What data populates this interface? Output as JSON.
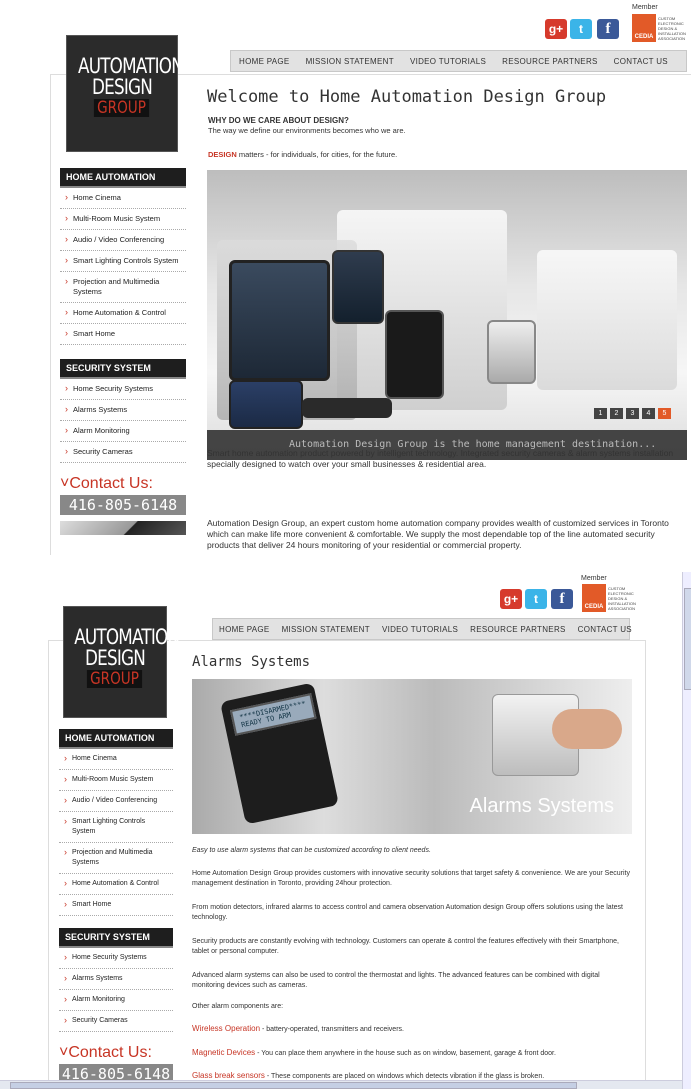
{
  "header": {
    "member_label": "Member",
    "social": {
      "gplus": "g+",
      "twitter": "t",
      "facebook": "f"
    },
    "cedia_label": "CEDIA",
    "cedia_text": "CUSTOM ELECTRONIC DESIGN & INSTALLATION ASSOCIATION",
    "nav": [
      "HOME PAGE",
      "MISSION STATEMENT",
      "VIDEO TUTORIALS",
      "RESOURCE PARTNERS",
      "CONTACT US"
    ]
  },
  "logo": {
    "line1": "AUTOMATION",
    "line2": "DESIGN",
    "line3": "GROUP"
  },
  "sidebar": {
    "home_heading": "HOME AUTOMATION",
    "home_items": [
      "Home Cinema",
      "Multi-Room Music System",
      "Audio / Video Conferencing",
      "Smart Lighting Controls System",
      "Projection and Multimedia Systems",
      "Home Automation & Control",
      "Smart Home"
    ],
    "security_heading": "SECURITY SYSTEM",
    "security_items": [
      "Home Security Systems",
      "Alarms Systems",
      "Alarm Monitoring",
      "Security Cameras"
    ],
    "contact_heading": "Contact Us:",
    "phone": "416-805-6148"
  },
  "page1": {
    "title": "Welcome to Home Automation Design Group",
    "why_heading": "WHY DO WE CARE ABOUT DESIGN?",
    "why_text": "The way we define our environments becomes who we are.",
    "design_word": "DESIGN",
    "design_text": " matters - for individuals, for cities, for the future.",
    "slider_caption": "Automation Design Group is the home management destination...",
    "slider_pages": [
      "1",
      "2",
      "3",
      "4",
      "5"
    ],
    "para1": "Smart home automation product powered by intelligent technology. Integrated security cameras & alarm systems installation specially designed to watch over your small businesses & residential area.",
    "para2": "Automation Design Group, an expert custom home automation company provides wealth of customized services in Toronto which can make life more convenient & comfortable. We supply the most dependable top of the line automated security products that deliver 24 hours monitoring of your residential or commercial property."
  },
  "page2": {
    "title": "Alarms Systems",
    "hero_title": "Alarms Systems",
    "lcd_line1": "****DISARMED****",
    "lcd_line2": "READY TO ARM",
    "intro": "Easy to use alarm systems that can be customized according to client needs.",
    "p1": "Home Automation Design Group provides customers with innovative security solutions that target safety & convenience. We are your Security management destination in Toronto, providing 24hour protection.",
    "p2": "From motion detectors, infrared alarms to access control and camera observation Automation design Group offers solutions using the latest technology.",
    "p3": "Security products are constantly evolving with technology. Customers can operate & control the features effectively with their Smartphone, tablet or personal computer.",
    "p4": "Advanced alarm systems can also be used to control the thermostat and lights. The advanced features can be combined with digital monitoring devices such as cameras.",
    "p5": "Other alarm components are:",
    "c1_label": "Wireless Operation",
    "c1_text": " - battery-operated, transmitters and receivers.",
    "c2_label": "Magnetic Devices",
    "c2_text": " - You can place them anywhere in the house such as on window, basement, garage & front door.",
    "c3_label": "Glass break sensors",
    "c3_text": " - These components are placed on windows which detects vibration if the glass is broken."
  },
  "colors": {
    "accent": "#c73525",
    "sidebar_heading": "#1e1e1e",
    "nav_bg": "#e2e2e2"
  }
}
